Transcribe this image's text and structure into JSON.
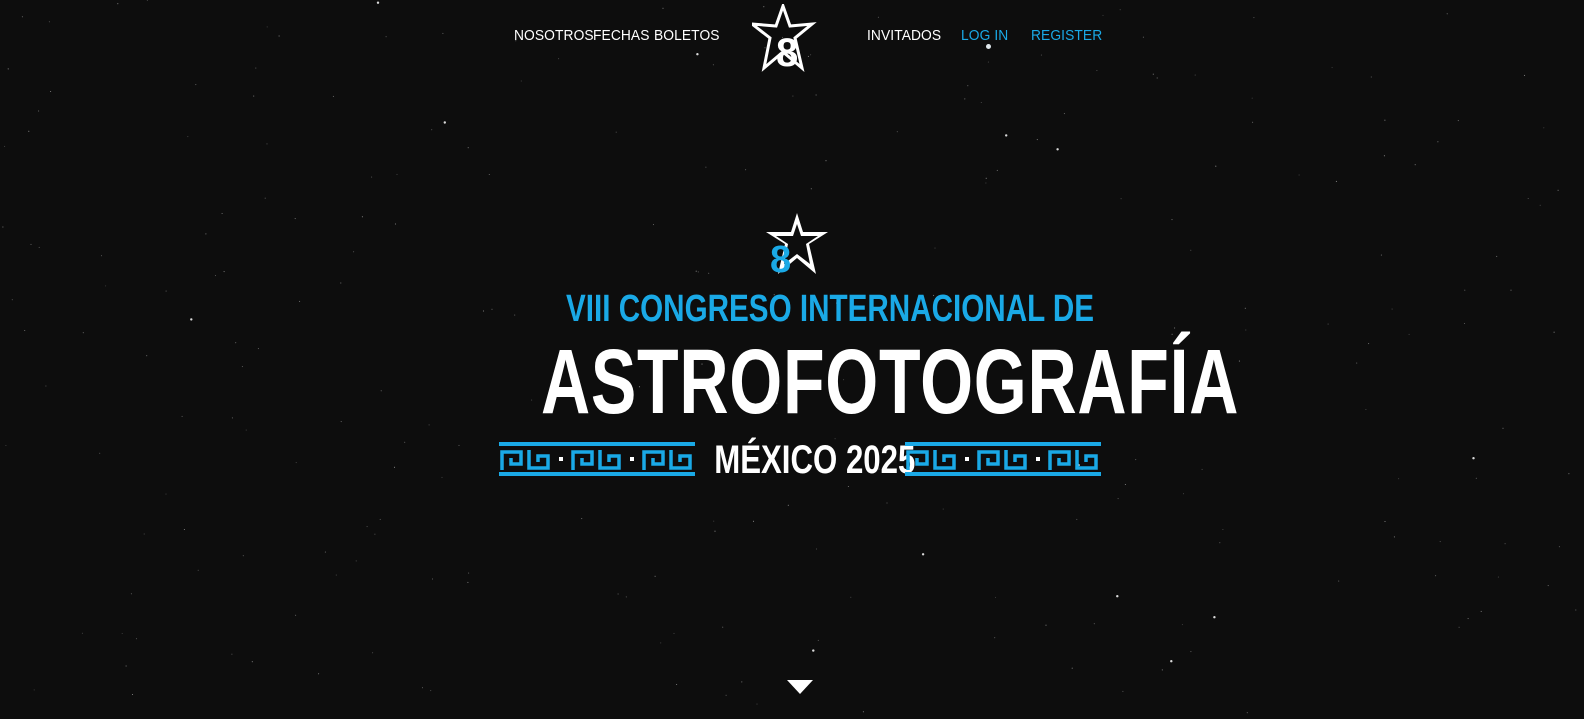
{
  "nav": {
    "nosotros": "NOSOTROS",
    "fechas": "FECHAS",
    "boletos": "BOLETOS",
    "invitados": "INVITADOS",
    "login": "LOG IN",
    "register": "REGISTER",
    "logo_icon": "star-8-logo-icon"
  },
  "hero": {
    "line1": "VIII CONGRESO INTERNACIONAL DE",
    "line2": "ASTROFOTOGRAFÍA",
    "line3": "MÉXICO 2025",
    "logo_icon": "star-8-logo-icon",
    "ornament_icon": "greek-fret-ornament-icon"
  },
  "scroll": {
    "icon": "chevron-down-icon"
  },
  "colors": {
    "background": "#0d0d0d",
    "accent": "#1aa9e6",
    "text": "#ffffff"
  }
}
